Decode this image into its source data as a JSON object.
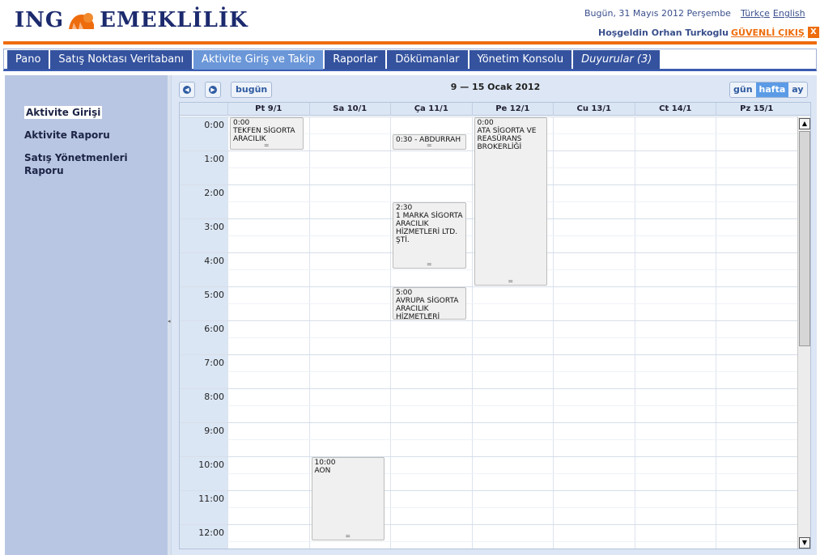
{
  "brand": {
    "part1": "ING",
    "part2": "EMEKLİLİK",
    "lion_color": "#ee6c0c",
    "text_color": "#1c2a6e"
  },
  "header": {
    "date": "Bugün,  31 Mayıs 2012 Perşembe",
    "lang_tr": "Türkçe",
    "lang_en": "English",
    "welcome": "Hoşgeldin Orhan Turkoglu",
    "logout": "GÜVENLİ ÇIKIŞ",
    "logout_icon": "X"
  },
  "nav": {
    "tabs": [
      "Pano",
      "Satış Noktası Veritabanı",
      "Aktivite Giriş ve Takip",
      "Raporlar",
      "Dökümanlar",
      "Yönetim Konsolu",
      "Duyurular (3)"
    ],
    "active_index": 2
  },
  "sidebar": {
    "items": [
      "Aktivite Girişi",
      "Aktivite Raporu",
      "Satış Yönetmenleri Raporu"
    ],
    "selected_index": 0
  },
  "calendar": {
    "today_btn": "bugün",
    "range": "9 — 15 Ocak 2012",
    "views": [
      "gün",
      "hafta",
      "ay"
    ],
    "active_view": "hafta",
    "days": [
      "Pt 9/1",
      "Sa 10/1",
      "Ça 11/1",
      "Pe 12/1",
      "Cu 13/1",
      "Ct 14/1",
      "Pz 15/1"
    ],
    "hours": [
      "0:00",
      "1:00",
      "2:00",
      "3:00",
      "4:00",
      "5:00",
      "6:00",
      "7:00",
      "8:00",
      "9:00",
      "10:00",
      "11:00",
      "12:00"
    ],
    "events": [
      {
        "day": 0,
        "start": 0.0,
        "end": 1.0,
        "time": "0:00",
        "title": "TEKFEN SİGORTA ARACILIK"
      },
      {
        "day": 2,
        "start": 0.5,
        "end": 1.0,
        "time": "",
        "title": "0:30 - ABDURRAH"
      },
      {
        "day": 2,
        "start": 2.5,
        "end": 4.5,
        "time": "2:30",
        "title": "1 MARKA SİGORTA ARACILIK HİZMETLERİ LTD. ŞTİ."
      },
      {
        "day": 3,
        "start": 0.0,
        "end": 5.0,
        "time": "0:00",
        "title": "ATA SİGORTA VE REASÜRANS BROKERLİĞİ"
      },
      {
        "day": 2,
        "start": 5.0,
        "end": 6.0,
        "time": "5:00",
        "title": "AVRUPA SİGORTA ARACILIK HİZMETLERİ"
      },
      {
        "day": 1,
        "start": 10.0,
        "end": 12.5,
        "time": "10:00",
        "title": "AON"
      }
    ]
  }
}
